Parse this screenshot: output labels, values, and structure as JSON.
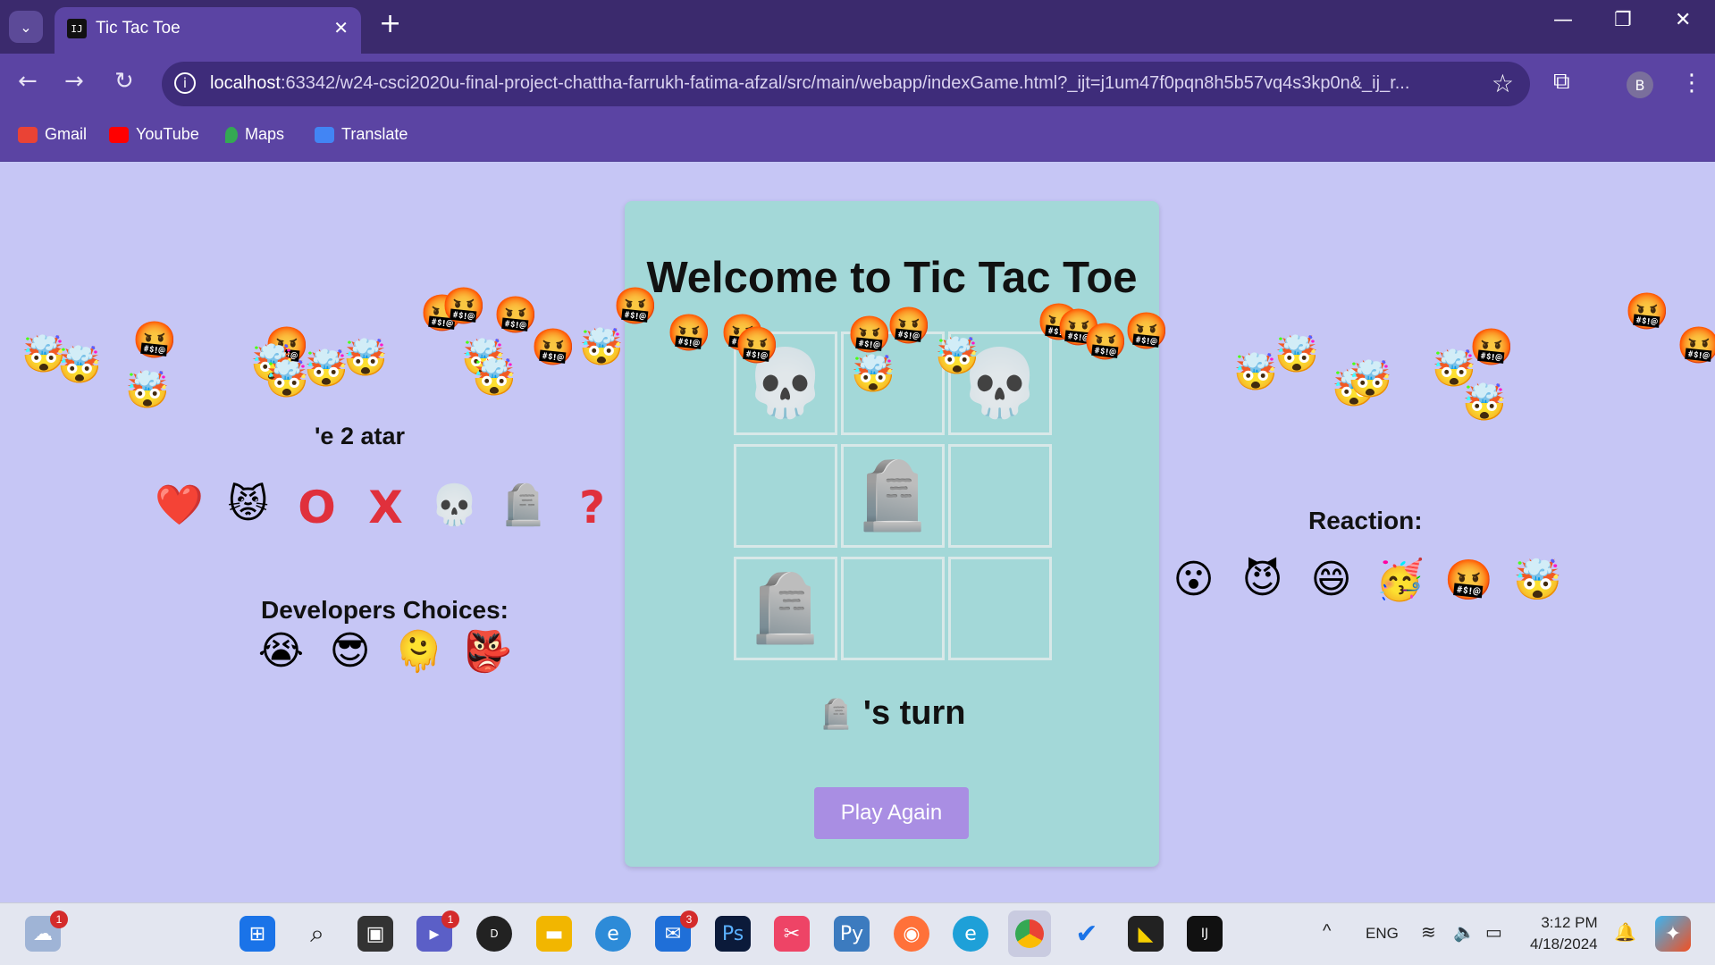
{
  "browser": {
    "tab_title": "Tic Tac Toe",
    "tab_favicon": "IJ",
    "url_host": "localhost",
    "url_rest": ":63342/w24-csci2020u-final-project-chattha-farrukh-fatima-afzal/src/main/webapp/indexGame.html?_ijt=j1um47f0pqn8h5b57vq4s3kp0n&_ij_r...",
    "profile_initial": "B",
    "bookmarks": [
      "Gmail",
      "YouTube",
      "Maps",
      "Translate"
    ]
  },
  "game": {
    "heading": "Welcome to Tic Tac Toe",
    "board": [
      "💀",
      "",
      "💀",
      "",
      "🪦",
      "",
      "🪦",
      "",
      ""
    ],
    "turn_symbol": "🪦",
    "turn_text": " 's turn",
    "play_again": "Play Again"
  },
  "left_panel": {
    "player_label_partial": "'e  2  atar",
    "avatars": [
      "❤️",
      "😾",
      "O",
      "X",
      "💀",
      "🪦",
      "?"
    ],
    "developers_label": "Developers Choices:",
    "developer_emojis": [
      "😭",
      "😎",
      "🫠",
      "👺"
    ]
  },
  "right_panel": {
    "reaction_label": "Reaction:",
    "reactions": [
      "😮",
      "😈",
      "😄",
      "🥳",
      "🤬",
      "🤯"
    ]
  },
  "taskbar": {
    "lang": "ENG",
    "time": "3:12 PM",
    "date": "4/18/2024",
    "weather_badge": "1",
    "teams_badge": "1",
    "mail_badge": "3"
  },
  "colors": {
    "page_bg": "#c6c6f5",
    "card_bg": "#a3d8d8",
    "button_bg": "#a98ee3",
    "chrome_dark": "#3b2a6d",
    "chrome": "#5b44a3"
  }
}
